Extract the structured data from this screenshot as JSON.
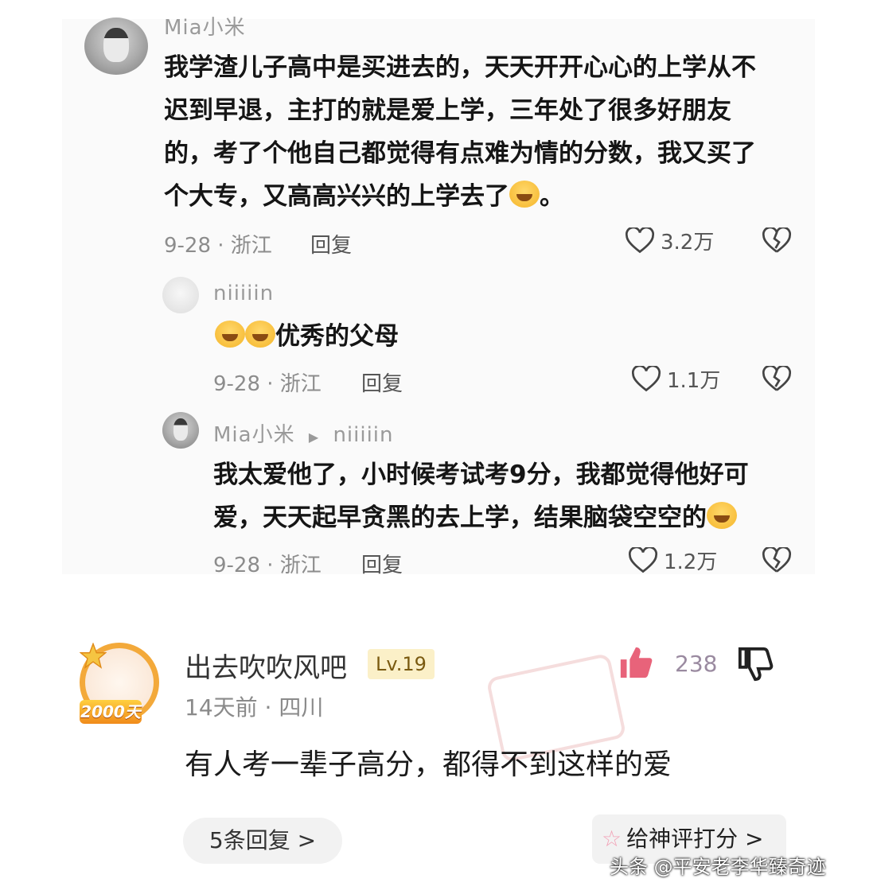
{
  "thread": {
    "main": {
      "username": "Mia小米",
      "text": "我学渣儿子高中是买进去的，天天开开心心的上学从不迟到早退，主打的就是爱上学，三年处了很多好朋友的，考了个他自己都觉得有点难为情的分数，我又买了个大专，又高高兴兴的上学去了",
      "suffix": "。",
      "date_loc": "9-28 · 浙江",
      "reply_label": "回复",
      "likes": "3.2万"
    },
    "reply1": {
      "username": "niiiiin",
      "text": "优秀的父母",
      "date_loc": "9-28 · 浙江",
      "reply_label": "回复",
      "likes": "1.1万"
    },
    "reply2": {
      "username": "Mia小米",
      "reply_to": "niiiiin",
      "text": "我太爱他了，小时候考试考9分，我都觉得他好可爱，天天起早贪黑的去上学，结果脑袋空空的",
      "date_loc": "9-28 · 浙江",
      "reply_label": "回复",
      "likes": "1.2万"
    }
  },
  "comment": {
    "username": "出去吹吹风吧",
    "level": "Lv.19",
    "days_badge": "2000天",
    "time_loc": "14天前 · 四川",
    "text": "有人考一辈子高分，都得不到这样的爱",
    "like_count": "238",
    "replies_label": "5条回复 >",
    "rate_label": "给神评打分 >"
  },
  "watermark": "头条 @平安老李华臻奇迹",
  "colors": {
    "like_thumb": "#e8637a",
    "level_bg": "#fbf0c8",
    "badge": "#f3a93a"
  }
}
